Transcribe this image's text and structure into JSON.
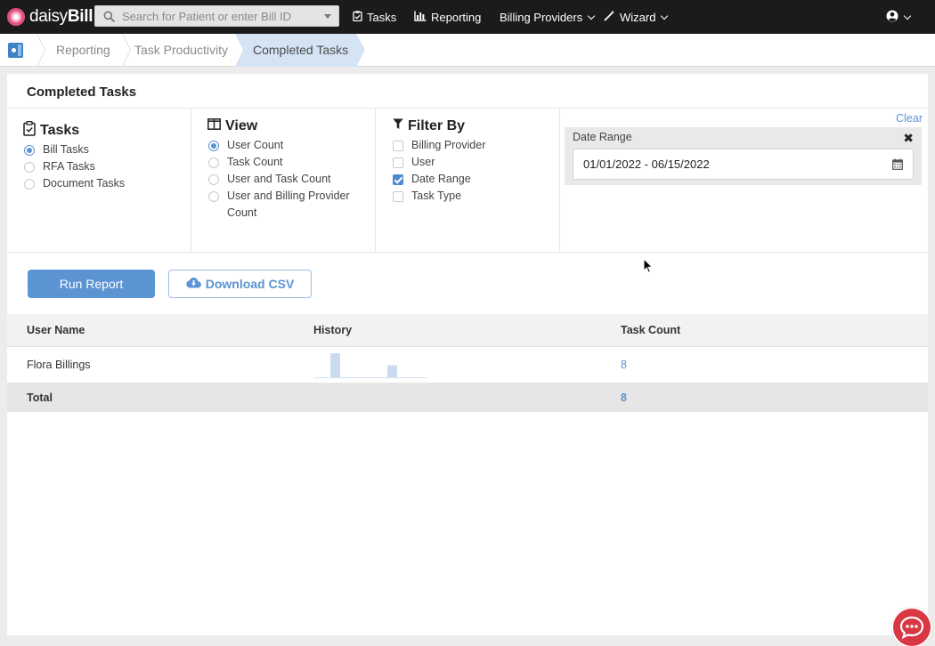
{
  "navbar": {
    "logo": {
      "prefix": "daisy",
      "suffix": "Bill"
    },
    "search_placeholder": "Search for Patient or enter Bill ID",
    "items": [
      {
        "label": "Tasks",
        "icon": "clipboard-check-icon"
      },
      {
        "label": "Reporting",
        "icon": "bar-chart-icon"
      },
      {
        "label": "Billing Providers",
        "icon": "chevron-down-icon"
      },
      {
        "label": "Wizard",
        "icon": "magic-wand-icon"
      }
    ],
    "user_icon": "user-circle-icon"
  },
  "breadcrumb": {
    "items": [
      "Reporting",
      "Task Productivity"
    ],
    "active": "Completed Tasks"
  },
  "page": {
    "title": "Completed Tasks",
    "clear_label": "Clear"
  },
  "tasks_panel": {
    "heading": "Tasks",
    "options": [
      "Bill Tasks",
      "RFA Tasks",
      "Document Tasks"
    ],
    "selected": "Bill Tasks"
  },
  "view_panel": {
    "heading": "View",
    "options": [
      "User Count",
      "Task Count",
      "User and Task Count",
      "User and Billing Provider Count"
    ],
    "selected": "User Count"
  },
  "filter_panel": {
    "heading": "Filter By",
    "options": [
      "Billing Provider",
      "User",
      "Date Range",
      "Task Type"
    ],
    "checked": [
      "Date Range"
    ]
  },
  "date_filter": {
    "label": "Date Range",
    "value": "01/01/2022 - 06/15/2022"
  },
  "buttons": {
    "run_report": "Run Report",
    "download_csv": "Download CSV"
  },
  "table": {
    "headers": [
      "User Name",
      "History",
      "Task Count"
    ],
    "rows": [
      {
        "user_name": "Flora Billings",
        "history": [
          0,
          4,
          0,
          0,
          0,
          2,
          0,
          0
        ],
        "task_count": "8"
      }
    ],
    "total": {
      "label": "Total",
      "task_count": "8"
    }
  },
  "colors": {
    "navbar": "#1b1b1b",
    "accent": "#5b93d3",
    "breadcrumb_active": "#d4e4f5",
    "chat": "#d93744"
  }
}
